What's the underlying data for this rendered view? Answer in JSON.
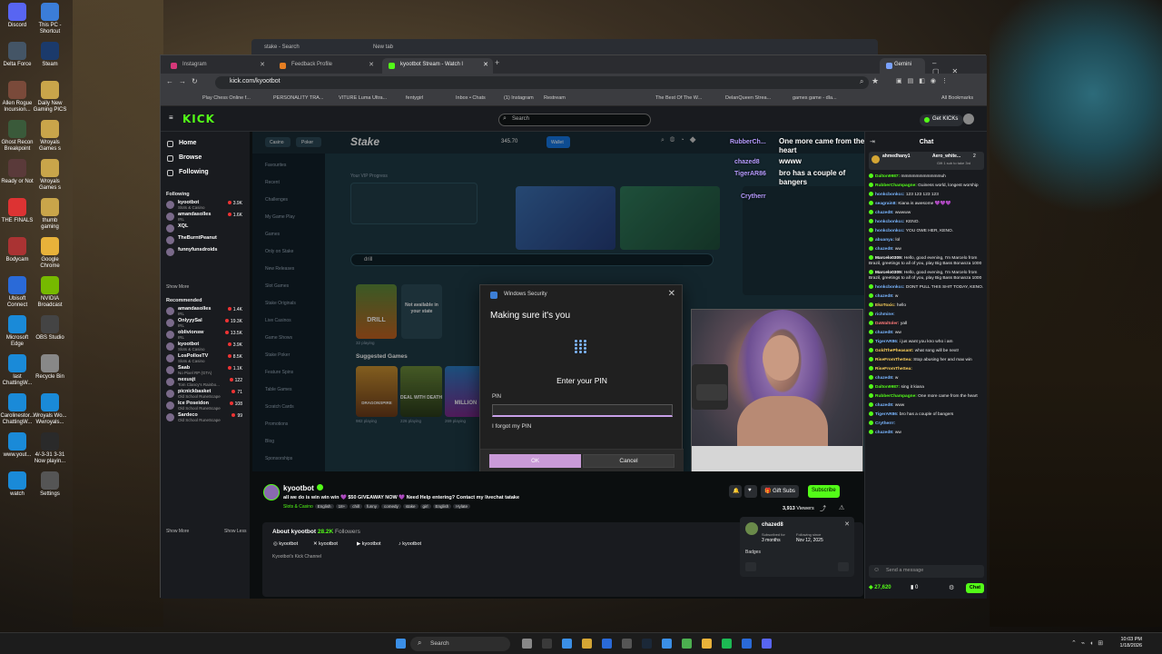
{
  "desktop": {
    "icons": [
      "Discord",
      "This PC - Shortcut",
      "Delta Force",
      "Steam",
      "Allen Rogue Incursion...",
      "Daily New Gaming PICS",
      "Ghost Recon Breakpoint",
      "Wroyals Games s",
      "Ready or Not",
      "Wroyals Games s",
      "THE FINALS",
      "thumb gaming",
      "Bodycam",
      "Google Chrome",
      "Ubisoft Connect",
      "NVIDIA Broadcast",
      "Microsoft Edge",
      "OBS Studio",
      "last ChattingW...",
      "Recycle Bin",
      "Carolinestor... ChattingW...",
      "Wroyals Wo... Wwroyals...",
      "www.yout...",
      "4/-3-31 3-31 Now playin...",
      "watch",
      "Settings"
    ]
  },
  "back_window": {
    "tabs": [
      "stake - Search",
      "New tab"
    ]
  },
  "browser": {
    "tabs": [
      "Instagram",
      "Feedback Profile",
      "kyootbot Stream - Watch l",
      "Gemini"
    ],
    "url": "kick.com/kyootbot",
    "bookmarks": [
      "Play Chess Online f...",
      "PERSONALITY TRA...",
      "VITURE Luma Ultra...",
      "fentygirl",
      "Inbox • Chats",
      "(1) Instagram",
      "Restream",
      "The Best Of The W...",
      "DelanQueen Strea...",
      "games game - dla...",
      "All Bookmarks"
    ]
  },
  "kick": {
    "logo": "KICK",
    "search_placeholder": "Search",
    "get_kicks": "Get KICKs",
    "nav": [
      "Home",
      "Browse",
      "Following"
    ],
    "following_label": "Following",
    "following": [
      {
        "name": "kyootbot",
        "cat": "Slots & Casino",
        "v": "3.9K"
      },
      {
        "name": "amandasolles",
        "cat": "IRL",
        "v": "1.6K"
      },
      {
        "name": "XQL",
        "cat": "",
        "v": ""
      },
      {
        "name": "TheBurntPeanut",
        "cat": "",
        "v": ""
      },
      {
        "name": "funnyfunsdroids",
        "cat": "",
        "v": ""
      }
    ],
    "show_more_1": "Show More",
    "recommended_label": "Recommended",
    "recommended": [
      {
        "name": "amandasolles",
        "cat": "IRL",
        "v": "1.4K"
      },
      {
        "name": "OnlyyySal",
        "cat": "IRL",
        "v": "19.3K"
      },
      {
        "name": "oblivionsw",
        "cat": "IRL",
        "v": "13.5K"
      },
      {
        "name": "kyootbot",
        "cat": "Slots & Casino",
        "v": "3.9K"
      },
      {
        "name": "LosPolloeTV",
        "cat": "Slots & Casino",
        "v": "8.5K"
      },
      {
        "name": "Saab",
        "cat": "No Pixel RP (GTA)",
        "v": "1.1K"
      },
      {
        "name": "nexusjt",
        "cat": "Tom Clancy's Rainbo...",
        "v": "122"
      },
      {
        "name": "picnickbasket",
        "cat": "Old School RuneScape",
        "v": "71"
      },
      {
        "name": "Ice Poseidon",
        "cat": "Old School RuneScape",
        "v": "108"
      },
      {
        "name": "Sardeco",
        "cat": "Old School RuneScape",
        "v": "99"
      }
    ],
    "show_more_2": "Show More",
    "show_less": "Show Less"
  },
  "stake": {
    "logo": "Stake",
    "tabs": [
      "Casino",
      "Poker"
    ],
    "balance": "345.70",
    "wallet": "Wallet",
    "search_val": "drill",
    "vip_label": "Your VIP Progress",
    "side": [
      "Favourites",
      "Recent",
      "Challenges",
      "My Game Play",
      "Games",
      "Only on Stake",
      "New Releases",
      "Slot Games",
      "Stake Originals",
      "Live Casinos",
      "Game Shows",
      "Stake Poker",
      "Feature Spins",
      "Table Games",
      "Scratch Cards",
      "Promotions",
      "Blog",
      "Sponsorships"
    ],
    "drill_label": "DRILL",
    "drill_playing": "32 playing",
    "not_available": "Not available in your state",
    "suggested_label": "Suggested Games",
    "games": [
      {
        "name": "DRAGONSPIRE",
        "p": "982 playing"
      },
      {
        "name": "DEAL WITH DEATH",
        "p": "226 playing"
      },
      {
        "name": "MILLION",
        "p": "269 playing"
      }
    ],
    "games_right": [
      "217 playing",
      "178 playing",
      "164 playing",
      "119 playing",
      "104 playing"
    ],
    "bottom_tiles": [
      "DEATH",
      "KILLING A",
      "RAISER",
      "ZEUS",
      "DOUBLES",
      "COIN"
    ],
    "bottom_row_label": "Bonus & Raffles"
  },
  "overlay_chat": [
    {
      "u": "RubberCh...",
      "t": "One more came from the heart"
    },
    {
      "u": "chazed8",
      "t": "wwww"
    },
    {
      "u": "TigerAR86",
      "t": "bro has a couple of bangers"
    },
    {
      "u": "Crytherr",
      "t": ""
    }
  ],
  "dialog": {
    "title": "Windows Security",
    "heading": "Making sure it's you",
    "enter": "Enter your PIN",
    "pin_label": "PIN",
    "pin_value": "",
    "forgot": "I forgot my PIN",
    "ok": "OK",
    "cancel": "Cancel"
  },
  "stream": {
    "name": "kyootbot",
    "title": "all we do is win win win 💜 $50 GIVEAWAY NOW 💜 Need Help entering? Contact my livechat tatake",
    "category": "Slots & Casino",
    "tags": [
      "English",
      "18+",
      "chill",
      "funny",
      "comedy",
      "stake",
      "girl",
      "English",
      "Hylate"
    ],
    "gift_subs": "Gift Subs",
    "subscribe": "Subscribe",
    "viewers": "3,913",
    "viewers_label": "Viewers",
    "about_title": "About kyootbot",
    "followers": "28.2K",
    "followers_label": "Followers",
    "socials": [
      "kyootbot",
      "kyootbot",
      "kyootbot",
      "kyootbot"
    ],
    "description": "Kyootbot's Kick Channel"
  },
  "sub_card": {
    "user": "chazed8",
    "subbed_label": "Subscribed for",
    "subbed": "3 months",
    "following_label": "Following since",
    "following": "Nov 12, 2025",
    "badges_label": "Badges"
  },
  "chat": {
    "title": "Chat",
    "pinned_user": "ahmedhany1",
    "pinned_user2": "Aero_white...",
    "pinned_count": "2",
    "pinned_text": "Gift 1 sub to take 3rd",
    "messages": [
      {
        "u": "Dalton9987:",
        "t": " mmmmmmmmmmmuh",
        "c": "#53fc18"
      },
      {
        "u": "RubberChampagne:",
        "t": " Guiness world, longest worship",
        "c": "#53fc18"
      },
      {
        "u": "honkcbonkcc:",
        "t": " 123 123 123 123",
        "c": "#7ab6ff"
      },
      {
        "u": "seagrain8:",
        "t": " Kiana is awesome 💜💜💜",
        "c": "#7ab6ff"
      },
      {
        "u": "chazed8:",
        "t": " wwwww",
        "c": "#7ab6ff"
      },
      {
        "u": "honkcbonkcc:",
        "t": " KENO.",
        "c": "#7ab6ff"
      },
      {
        "u": "honkcbonkcc:",
        "t": " YOU OWE HER, KENO.",
        "c": "#7ab6ff"
      },
      {
        "u": "abuanya:",
        "t": " lol",
        "c": "#7ab6ff"
      },
      {
        "u": "chazed8:",
        "t": " ww",
        "c": "#7ab6ff"
      },
      {
        "u": "Marcelo0309:",
        "t": " Hello, good evening, I'm Marcelo from Brazil, greetings to all of you, play Big Bass Bonanza 1000",
        "c": "#fff"
      },
      {
        "u": "Marcelo0309:",
        "t": " Hello, good evening, I'm Marcelo from Brazil, greetings to all of you, play Big Bass Bonanza 1000",
        "c": "#fff"
      },
      {
        "u": "honkcbonkcc:",
        "t": " DONT PULL THIS SHIT TODAY, KENO.",
        "c": "#7ab6ff"
      },
      {
        "u": "chazed8:",
        "t": " w",
        "c": "#7ab6ff"
      },
      {
        "u": "EkoToxic:",
        "t": " hello",
        "c": "#ffd35c"
      },
      {
        "u": "richmine:",
        "t": "",
        "c": "#7ab6ff"
      },
      {
        "u": "DaWaltoler:",
        "t": " yall",
        "c": "#ff7a7a"
      },
      {
        "u": "chazed8:",
        "t": " ww",
        "c": "#7ab6ff"
      },
      {
        "u": "TigerAR86:",
        "t": " i jus want you kno who i am",
        "c": "#7ab6ff"
      },
      {
        "u": "GoldThePheasant:",
        "t": " what song will be next!",
        "c": "#ffd35c"
      },
      {
        "u": "RiseFromTheSea:",
        "t": " Stop abusing her and max win",
        "c": "#ffd35c"
      },
      {
        "u": "RiseFromTheSea:",
        "t": "",
        "c": "#ffd35c"
      },
      {
        "u": "chazed8:",
        "t": " w",
        "c": "#7ab6ff"
      },
      {
        "u": "Dalton9987:",
        "t": " sing it kiana",
        "c": "#53fc18"
      },
      {
        "u": "RubberChampagne:",
        "t": " One more came from the heart",
        "c": "#53fc18"
      },
      {
        "u": "chazed8:",
        "t": " www",
        "c": "#7ab6ff"
      },
      {
        "u": "TigerAR86:",
        "t": " bro has a couple of bangers",
        "c": "#7ab6ff"
      },
      {
        "u": "Crytherrr:",
        "t": "",
        "c": "#7ab6ff"
      },
      {
        "u": "chazed8:",
        "t": " ww",
        "c": "#7ab6ff"
      }
    ],
    "input_placeholder": "Send a message",
    "points": "27,620",
    "zero": "0",
    "send": "Chat"
  },
  "taskbar": {
    "search": "Search",
    "time": "10:03 PM",
    "date": "1/18/2026"
  },
  "colors": {
    "kick_green": "#53fc18",
    "stake_bg": "#1e3a44",
    "dialog_accent": "#c99ad8"
  }
}
